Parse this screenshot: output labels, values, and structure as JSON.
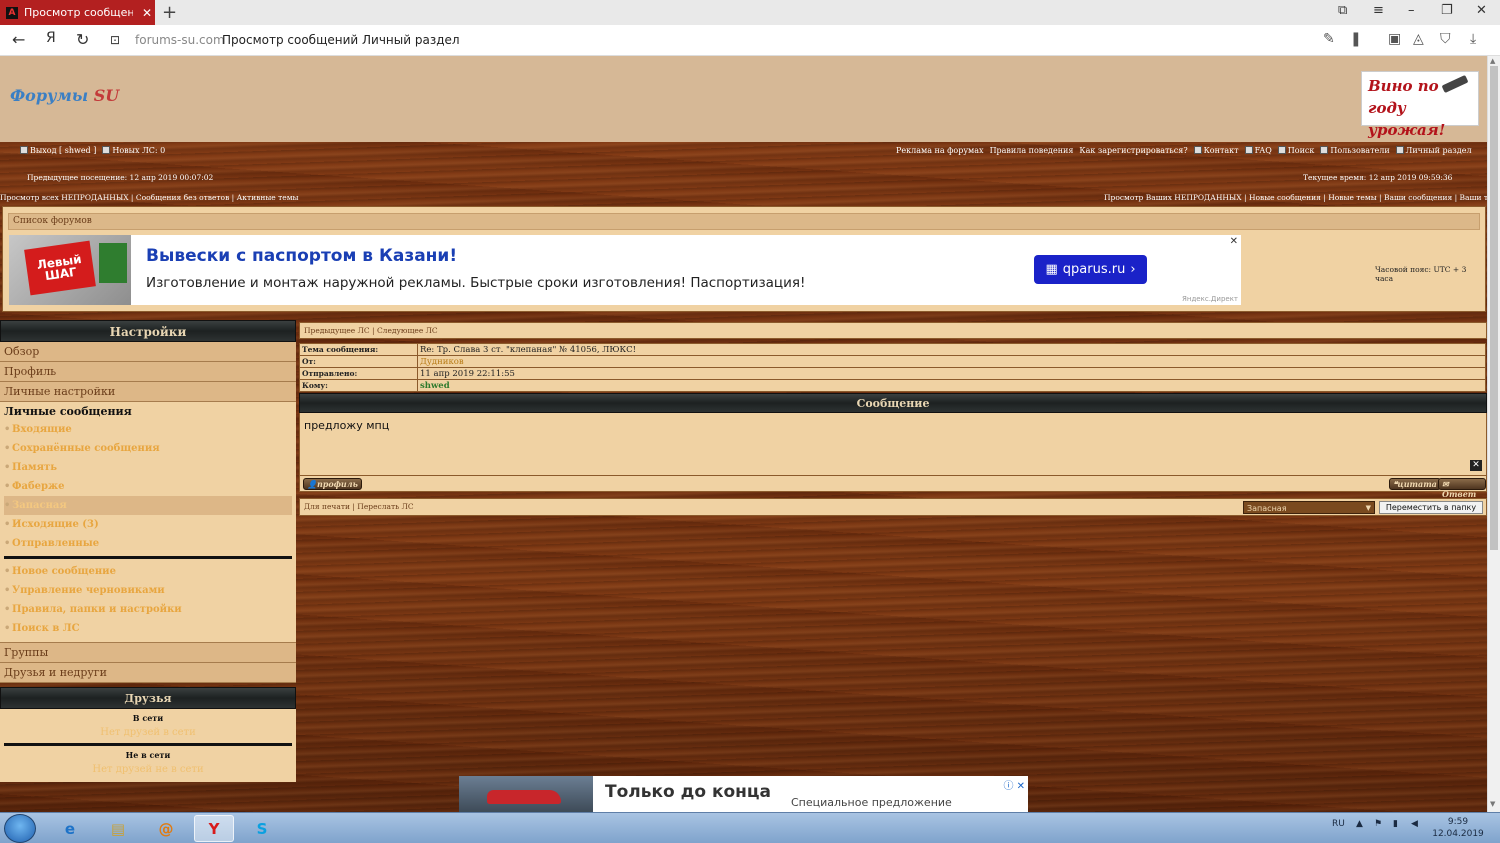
{
  "browser": {
    "tab_title": "Просмотр сообщений Л",
    "tab_logo": "A",
    "tab_close": "✕",
    "new_tab": "+",
    "url_domain": "forums-su.com",
    "url_title": "Просмотр сообщений Личный раздел",
    "icons": [
      "back-arrow-icon",
      "yandex-y-icon",
      "reload-icon",
      "site-info-icon",
      "pen-icon",
      "bookmark-icon",
      "camera-icon",
      "protect-icon",
      "shield-icon",
      "download-icon",
      "menu-icon",
      "minimize-icon",
      "restore-icon",
      "close-icon"
    ]
  },
  "header": {
    "logo_main": "Форумы",
    "logo_su": "SU",
    "wine_ad_line1": "Вино по",
    "wine_ad_line2": "году урожая!"
  },
  "toplinks": {
    "left": [
      "Выход [ shwed ]",
      "Новых ЛС: 0"
    ],
    "right": [
      "Реклама на форумах",
      "Правила поведения",
      "Как зарегистрироваться?",
      "Контакт",
      "FAQ",
      "Поиск",
      "Пользователи",
      "Личный раздел"
    ]
  },
  "visits": {
    "last_visit": "Предыдущее посещение: 12 апр 2019 00:07:02",
    "current_time": "Текущее время: 12 апр 2019 09:59:36"
  },
  "quicklinks": {
    "left": [
      "Просмотр всех НЕПРОДАННЫХ",
      "Сообщения без ответов",
      "Активные темы"
    ],
    "right": [
      "Просмотр Ваших НЕПРОДАННЫХ",
      "Новые сообщения",
      "Новые темы",
      "Ваши сообщения",
      "Ваши темы"
    ]
  },
  "forumbox": {
    "forum_list": "Список форумов",
    "timezone": "Часовой пояс: UTC + 3 часа"
  },
  "ad": {
    "sign": "Левый ШАГ",
    "title": "Вывески с паспортом в Казани!",
    "text": "Изготовление и монтаж наружной рекламы. Быстрые сроки изготовления! Паспортизация!",
    "button": "qparus.ru",
    "close": "✕",
    "source": "Яндекс.Директ"
  },
  "sidebar": {
    "settings_title": "Настройки",
    "items_top": [
      "Обзор",
      "Профиль",
      "Личные настройки"
    ],
    "pm_title": "Личные сообщения",
    "pm_items": [
      "Входящие",
      "Сохранённые сообщения",
      "Память",
      "Фаберже",
      "Запасная",
      "Исходящие (3)",
      "Отправленные"
    ],
    "pm_active_index": 4,
    "pm_tools": [
      "Новое сообщение",
      "Управление черновиками",
      "Правила, папки и настройки",
      "Поиск в ЛС"
    ],
    "items_bottom": [
      "Группы",
      "Друзья и недруги"
    ],
    "friends_title": "Друзья",
    "online_label": "В сети",
    "online_none": "Нет друзей в сети",
    "offline_label": "Не в сети",
    "offline_none": "Нет друзей не в сети"
  },
  "message": {
    "nav_prev": "Предыдущее ЛС",
    "nav_next": "Следующее ЛС",
    "fields": [
      {
        "key": "Тема сообщения:",
        "value": "Re: Тр. Слава 3 ст. \"клепаная\" № 41056, ЛЮКС!"
      },
      {
        "key": "От:",
        "value": "Дудников"
      },
      {
        "key": "Отправлено:",
        "value": "11 апр 2019 22:11:55"
      },
      {
        "key": "Кому:",
        "value": "shwed"
      }
    ],
    "header": "Сообщение",
    "body": "предложу мпц",
    "profile_btn": "профиль",
    "quote_btn": "цитата",
    "reply_btn": "Ответ",
    "print_link": "Для печати",
    "forward_link": "Переслать ЛС",
    "folder_selected": "Запасная",
    "move_btn": "Переместить в папку"
  },
  "bottom_ad": {
    "title": "Только до конца",
    "sub": "Специальное предложение",
    "icons": "ⓘ ✕"
  },
  "taskbar": {
    "lang": "RU",
    "time": "9:59",
    "date": "12.04.2019",
    "apps": [
      "ie-icon",
      "explorer-icon",
      "mail-icon",
      "yandex-browser-icon",
      "skype-icon"
    ]
  }
}
